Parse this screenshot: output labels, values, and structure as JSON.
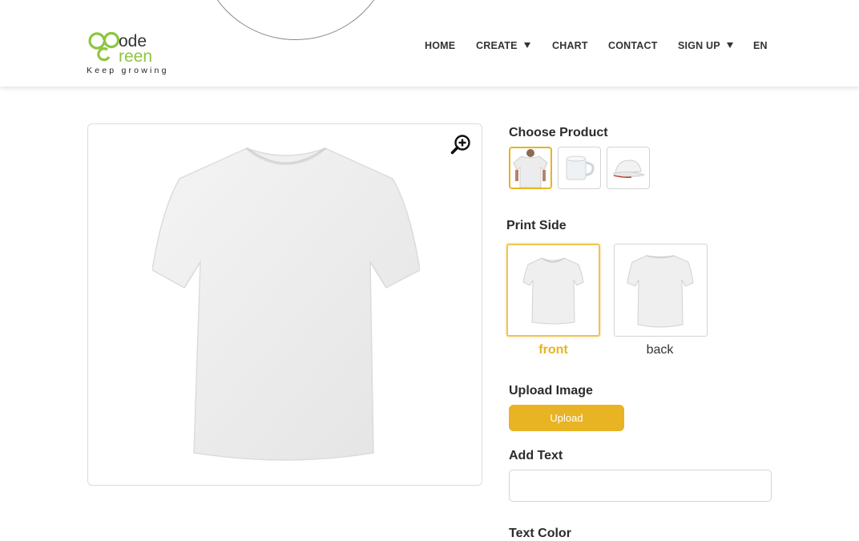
{
  "brand": {
    "logo_text": "Code Green",
    "tagline": "Keep growing",
    "colors": {
      "green": "#8dc63f",
      "dark": "#333333"
    }
  },
  "nav": {
    "items": [
      {
        "label": "HOME",
        "dropdown": false
      },
      {
        "label": "CREATE",
        "dropdown": true
      },
      {
        "label": "CHART",
        "dropdown": false
      },
      {
        "label": "CONTACT",
        "dropdown": false
      },
      {
        "label": "SIGN UP",
        "dropdown": true
      },
      {
        "label": "EN",
        "dropdown": false
      }
    ]
  },
  "preview": {
    "zoom_icon": "zoom-in-icon",
    "product": "t-shirt-front"
  },
  "choose_product": {
    "label": "Choose Product",
    "options": [
      {
        "name": "t-shirt",
        "selected": true
      },
      {
        "name": "mug",
        "selected": false
      },
      {
        "name": "cap",
        "selected": false
      }
    ]
  },
  "print_side": {
    "label": "Print Side",
    "options": [
      {
        "label": "front",
        "selected": true
      },
      {
        "label": "back",
        "selected": false
      }
    ]
  },
  "upload": {
    "label": "Upload Image",
    "button_label": "Upload"
  },
  "add_text": {
    "label": "Add Text",
    "value": "",
    "placeholder": ""
  },
  "text_color": {
    "label": "Text Color"
  },
  "colors": {
    "accent": "#e8b423",
    "border": "#d4d4d4"
  }
}
